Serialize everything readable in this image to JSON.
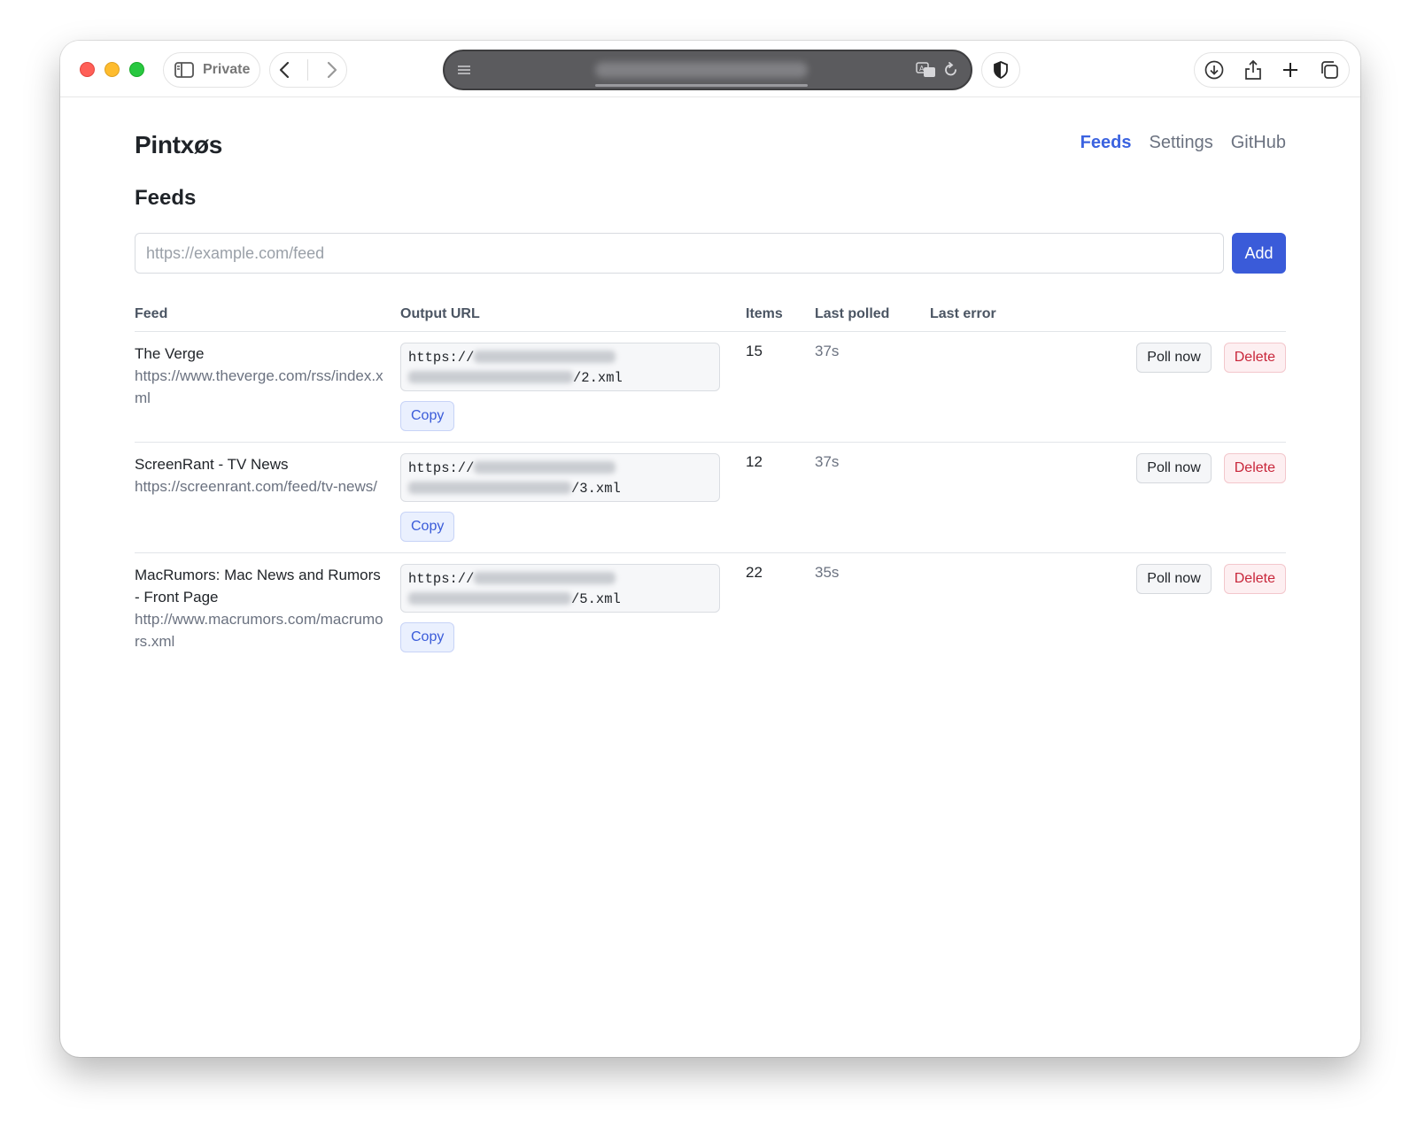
{
  "browser": {
    "private_label": "Private"
  },
  "app": {
    "brand": "Pintxøs",
    "nav": [
      {
        "label": "Feeds"
      },
      {
        "label": "Settings"
      },
      {
        "label": "GitHub"
      }
    ]
  },
  "page": {
    "heading": "Feeds",
    "input_placeholder": "https://example.com/feed",
    "input_value": "",
    "add_label": "Add"
  },
  "table": {
    "headers": [
      "Feed",
      "Output URL",
      "Items",
      "Last polled",
      "Last error",
      ""
    ],
    "copy_label": "Copy",
    "poll_label": "Poll now",
    "delete_label": "Delete",
    "rows": [
      {
        "title": "The Verge",
        "source": "https://www.theverge.com/rss/index.xml",
        "out_prefix": "https://",
        "out_suffix": "/2.xml",
        "items": "15",
        "last_polled": "37s",
        "last_error": ""
      },
      {
        "title": "ScreenRant - TV News",
        "source": "https://screenrant.com/feed/tv-news/",
        "out_prefix": "https://",
        "out_suffix": "/3.xml",
        "items": "12",
        "last_polled": "37s",
        "last_error": ""
      },
      {
        "title": "MacRumors: Mac News and Rumors - Front Page",
        "source": "http://www.macrumors.com/macrumors.xml",
        "out_prefix": "https://",
        "out_suffix": "/5.xml",
        "items": "22",
        "last_polled": "35s",
        "last_error": ""
      }
    ]
  },
  "colors": {
    "accent": "#3a5bd9",
    "danger": "#c8263a"
  }
}
